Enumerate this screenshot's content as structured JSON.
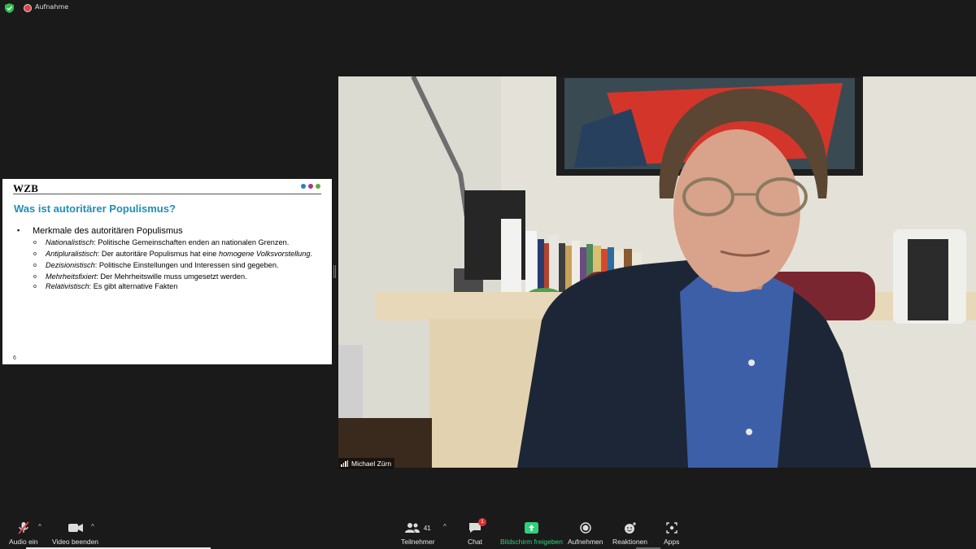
{
  "topbar": {
    "recording_label": "Aufnahme",
    "shield_color": "#2fbf4f",
    "record_color": "#d94545"
  },
  "slide": {
    "logo": "WZB",
    "dot_colors": [
      "#2b7fc1",
      "#a8348f",
      "#64a844"
    ],
    "title": "Was ist autoritärer Populismus?",
    "bullet": "Merkmale des autoritären Populismus",
    "items": [
      {
        "term": "Nationalistisch",
        "text": ": Politische Gemeinschaften enden an nationalen Grenzen."
      },
      {
        "term": "Antipluralistisch",
        "text": ": Der autoritäre Populismus hat eine ",
        "em": "homogene Volksvorstellung",
        "tail": "."
      },
      {
        "term": "Dezisionistisch",
        "text": ": Politische Einstellungen und Interessen sind gegeben."
      },
      {
        "term": "Mehrheitsfixiert",
        "text": ": Der Mehrheitswille muss umgesetzt werden."
      },
      {
        "term": "Relativistisch",
        "text": ": Es gibt alternative Fakten"
      }
    ],
    "page_number": "6",
    "title_color": "#1f8fb8"
  },
  "video": {
    "participant_name": "Michael Zürn"
  },
  "toolbar": {
    "audio_label": "Audio ein",
    "video_label": "Video beenden",
    "participants_label": "Teilnehmer",
    "participants_count": "41",
    "chat_label": "Chat",
    "chat_badge": "1",
    "share_label": "Bildschirm freigeben",
    "record_label": "Aufnehmen",
    "reactions_label": "Reaktionen",
    "apps_label": "Apps",
    "share_color": "#2ed17a"
  }
}
